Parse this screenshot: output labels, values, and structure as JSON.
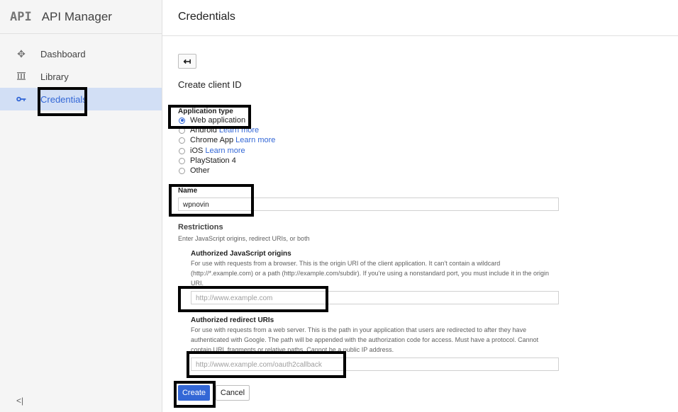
{
  "app": {
    "logo": "API",
    "title": "API Manager"
  },
  "nav": [
    {
      "icon": "dashboard-icon",
      "label": "Dashboard"
    },
    {
      "icon": "library-icon",
      "label": "Library"
    },
    {
      "icon": "key-icon",
      "label": "Credentials"
    }
  ],
  "collapse_symbol": "<|",
  "page_title": "Credentials",
  "form": {
    "heading": "Create client ID",
    "app_type_label": "Application type",
    "options": [
      {
        "label": "Web application",
        "link": ""
      },
      {
        "label": "Android",
        "link": "Learn more"
      },
      {
        "label": "Chrome App",
        "link": "Learn more"
      },
      {
        "label": "iOS",
        "link": "Learn more"
      },
      {
        "label": "PlayStation 4",
        "link": ""
      },
      {
        "label": "Other",
        "link": ""
      }
    ],
    "selected_option": "Web application",
    "name_label": "Name",
    "name_value": "wpnovin",
    "restrictions_title": "Restrictions",
    "restrictions_help": "Enter JavaScript origins, redirect URIs, or both",
    "js_origins": {
      "title": "Authorized JavaScript origins",
      "help": "For use with requests from a browser. This is the origin URI of the client application. It can't contain a wildcard (http://*.example.com) or a path (http://example.com/subdir). If you're using a nonstandard port, you must include it in the origin URI.",
      "placeholder": "http://www.example.com"
    },
    "redirect_uris": {
      "title": "Authorized redirect URIs",
      "help": "For use with requests from a web server. This is the path in your application that users are redirected to after they have authenticated with Google. The path will be appended with the authorization code for access. Must have a protocol. Cannot contain URL fragments or relative paths. Cannot be a public IP address.",
      "placeholder": "http://www.example.com/oauth2callback"
    },
    "create_label": "Create",
    "cancel_label": "Cancel"
  },
  "colors": {
    "accent": "#3367d6",
    "active_nav_bg": "#d2dff5",
    "highlight_box": "#000000"
  }
}
